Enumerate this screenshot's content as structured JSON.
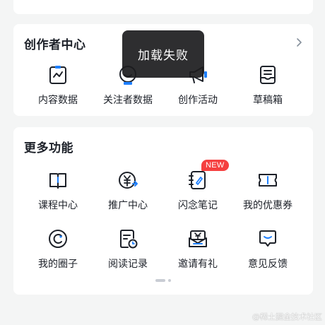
{
  "creator_center": {
    "title": "创作者中心",
    "items": [
      {
        "label": "内容数据",
        "icon": "chart-doc-icon"
      },
      {
        "label": "关注者数据",
        "icon": "smile-badge-icon"
      },
      {
        "label": "创作活动",
        "icon": "megaphone-icon"
      },
      {
        "label": "草稿箱",
        "icon": "drafts-tray-icon"
      }
    ]
  },
  "more_features": {
    "title": "更多功能",
    "items": [
      {
        "label": "课程中心",
        "icon": "book-icon"
      },
      {
        "label": "推广中心",
        "icon": "yuan-share-icon"
      },
      {
        "label": "闪念笔记",
        "icon": "notebook-icon",
        "badge": "NEW"
      },
      {
        "label": "我的优惠券",
        "icon": "coupon-icon"
      },
      {
        "label": "我的圈子",
        "icon": "circle-icon"
      },
      {
        "label": "阅读记录",
        "icon": "reading-history-icon"
      },
      {
        "label": "邀请有礼",
        "icon": "gift-box-icon"
      },
      {
        "label": "意见反馈",
        "icon": "feedback-icon"
      }
    ]
  },
  "toast": {
    "message": "加载失败"
  },
  "watermark": "@稀土掘金技术社区",
  "colors": {
    "accent": "#1e80ff",
    "badge": "#f53f3f",
    "text": "#1d2129"
  }
}
